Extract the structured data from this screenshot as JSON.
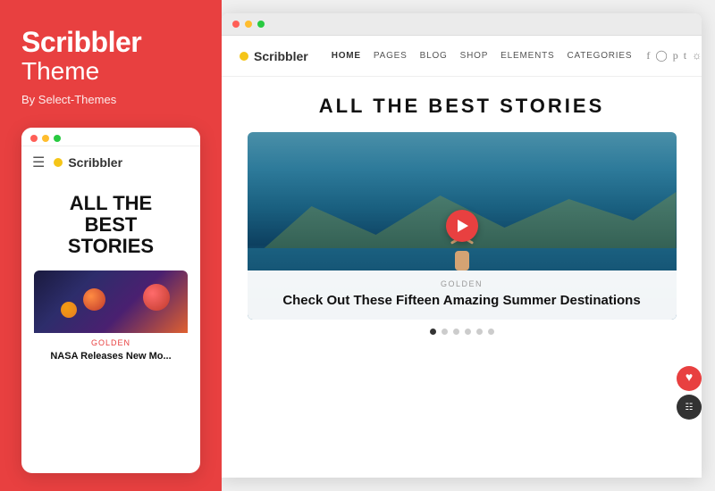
{
  "left": {
    "brand_name": "Scribbler",
    "brand_subtitle": "Theme",
    "brand_by": "By Select-Themes",
    "mobile_logo": "Scribbler",
    "hero_headline_line1": "ALL THE",
    "hero_headline_line2": "BEST",
    "hero_headline_line3": "STORIES",
    "article_label": "GOLDEN",
    "article_title": "NASA Releases New Mo..."
  },
  "right": {
    "nav_logo": "Scribbler",
    "nav_links": [
      "HOME",
      "PAGES",
      "BLOG",
      "SHOP",
      "ELEMENTS",
      "CATEGORIES"
    ],
    "hero_title": "ALL THE BEST STORIES",
    "caption_label": "GOLDEN",
    "caption_title": "Check Out These Fifteen Amazing Summer Destinations",
    "slider_dots_count": 6,
    "slider_active": 0
  },
  "colors": {
    "accent": "#e84040",
    "logo_dot": "#f5c518"
  }
}
